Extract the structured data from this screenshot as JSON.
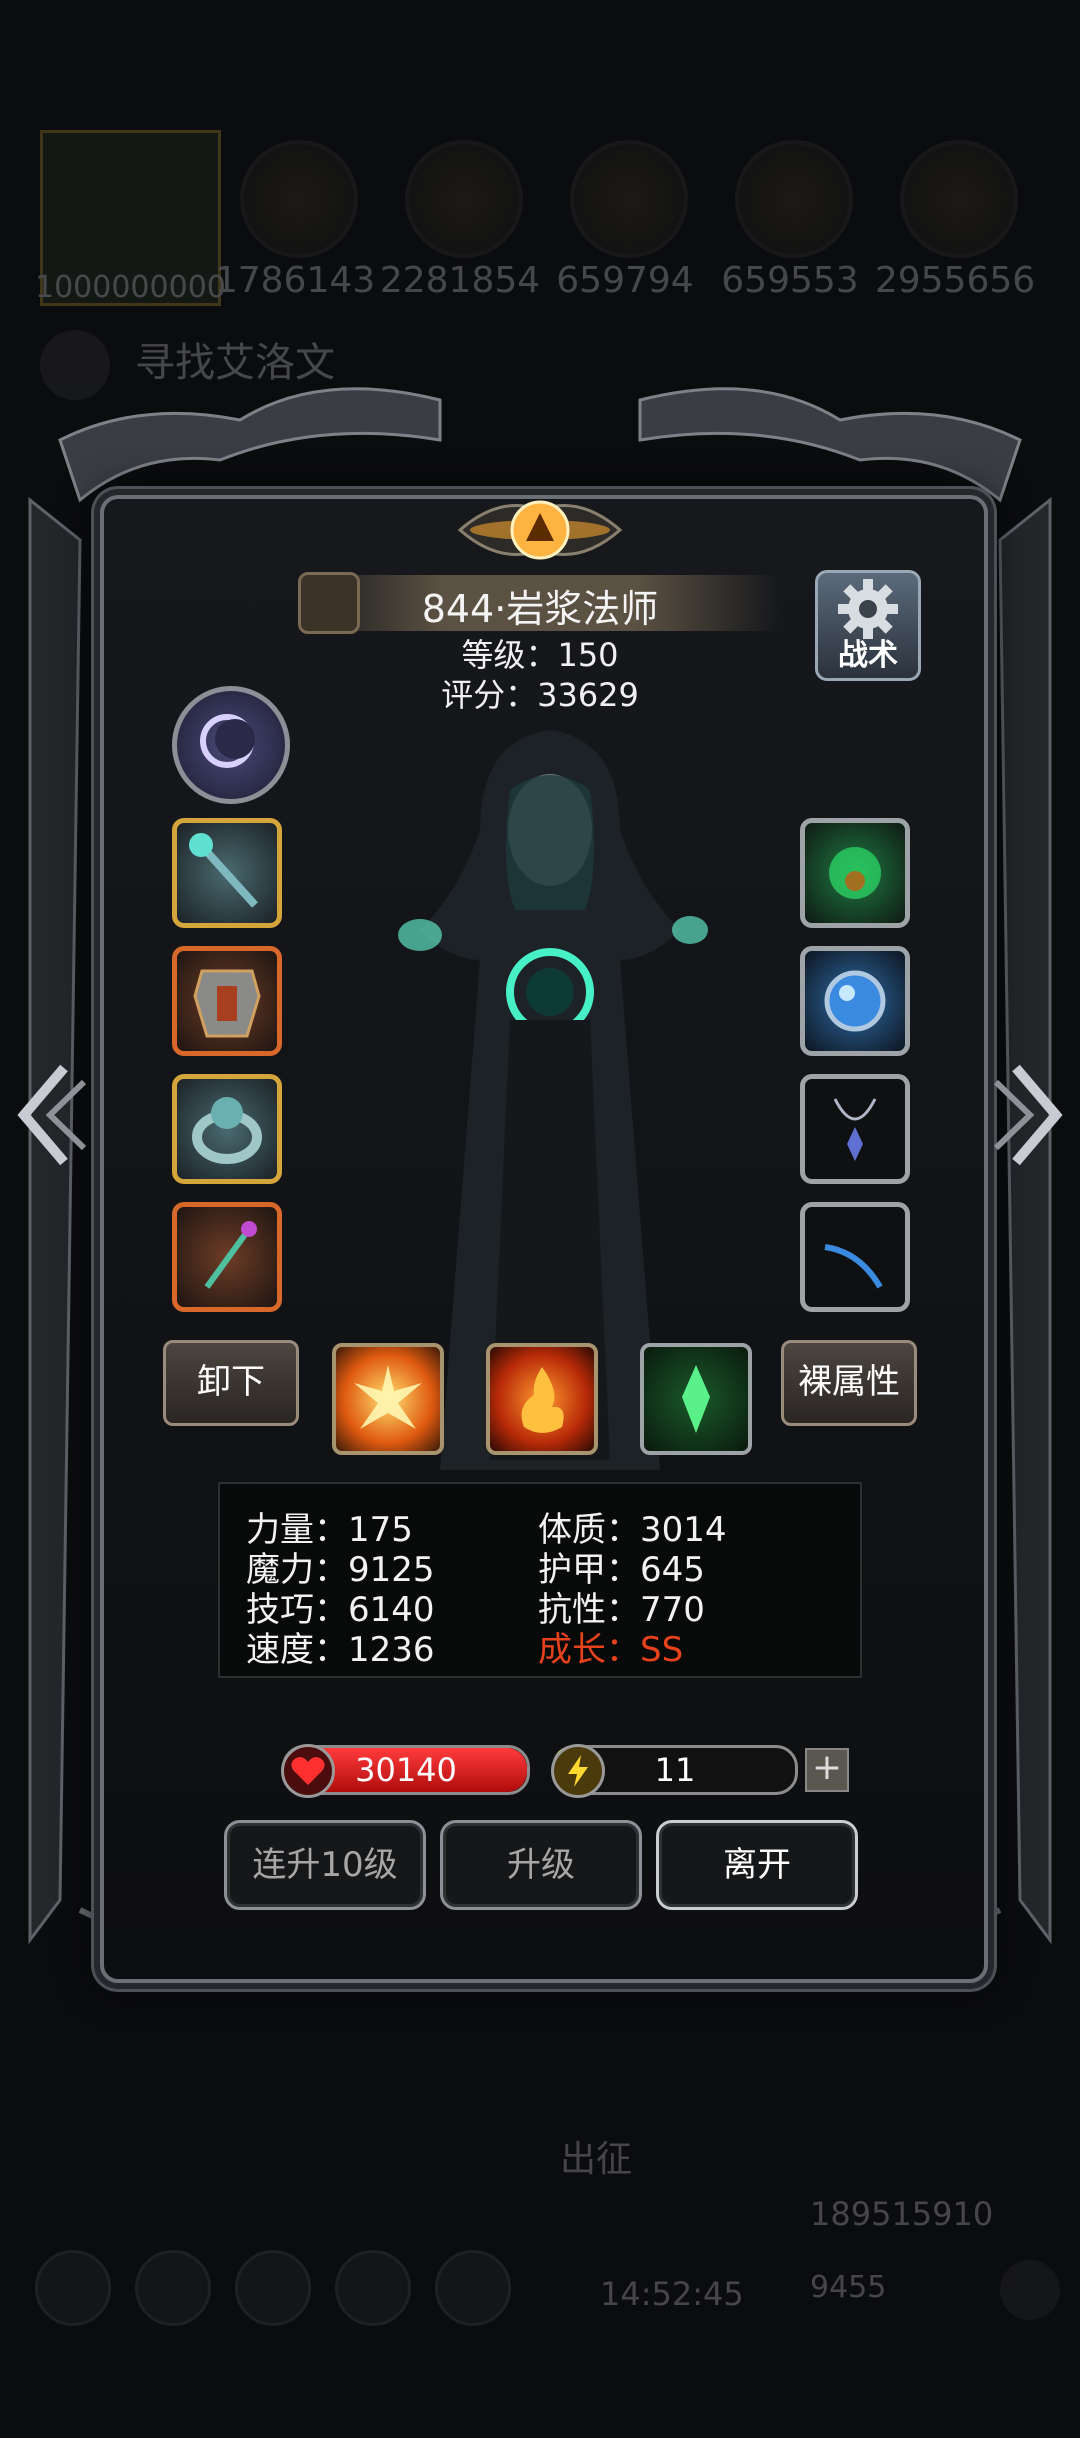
{
  "background": {
    "portrait_value": "1000000000",
    "resources": [
      "1786143",
      "2281854",
      "659794",
      "659553",
      "2955656"
    ],
    "quest": "寻找艾洛文",
    "bottom_label": "出征",
    "gold": "189515910",
    "gems": "9455",
    "time": "14:52:45"
  },
  "hero": {
    "name": "844·岩浆法师",
    "level": "等级：150",
    "score": "评分：33629",
    "tactics_label": "战术"
  },
  "equipment": {
    "left_slots": [
      "staff-icon",
      "armor-icon",
      "ring-icon",
      "wand-icon"
    ],
    "right_slots": [
      "amulet-green-icon",
      "orb-icon",
      "necklace-icon",
      "feather-icon"
    ]
  },
  "buttons": {
    "unequip": "卸下",
    "raw_attributes": "裸属性",
    "upgrade10": "连升10级",
    "upgrade": "升级",
    "leave": "离开"
  },
  "skills": [
    "fire-burst-icon",
    "flame-icon",
    "crystal-icon"
  ],
  "attributes": {
    "strength": "力量：175",
    "magic": "魔力：9125",
    "skill": "技巧：6140",
    "speed": "速度：1236",
    "constitution": "体质：3014",
    "armor": "护甲：645",
    "resistance": "抗性：770",
    "growth": "成长：SS"
  },
  "bars": {
    "hp": "30140",
    "energy": "11",
    "hp_fill": 1.0,
    "energy_fill": 0.1
  },
  "colors": {
    "accent_red": "#e8421d",
    "hp_red": "#d11a1a",
    "energy_yellow": "#e8c32a"
  }
}
